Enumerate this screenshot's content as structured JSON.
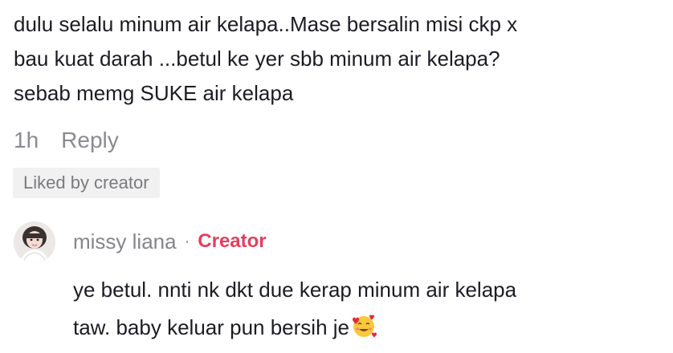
{
  "comment": {
    "text": "dulu selalu minum air kelapa..Mase bersalin misi ckp x\nbau kuat darah ...betul ke yer sbb minum air kelapa?\nsebab memg SUKE air kelapa",
    "time": "1h",
    "reply_label": "Reply",
    "liked_badge": "Liked by creator"
  },
  "reply": {
    "author": "missy liana",
    "separator": "·",
    "creator_label": "Creator",
    "text": "ye betul. nnti nk dkt due kerap minum air kelapa\ntaw. baby keluar pun bersih je",
    "emoji": "smiling-face-with-hearts-icon"
  },
  "colors": {
    "creator": "#e63e5c",
    "muted": "#8a8b91",
    "badge_bg": "#f1f1f2"
  }
}
